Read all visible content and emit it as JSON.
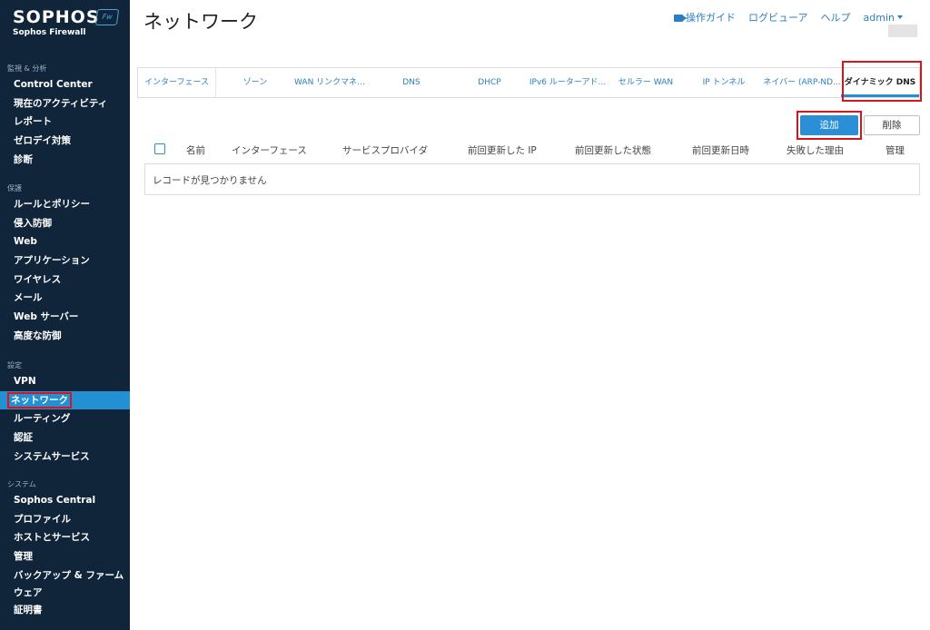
{
  "brand": {
    "logo": "SOPHOS",
    "badge": "Fw",
    "product": "Sophos Firewall"
  },
  "header": {
    "title": "ネットワーク",
    "links": {
      "guide": "操作ガイド",
      "log_viewer": "ログビューア",
      "help": "ヘルプ",
      "user": "admin"
    }
  },
  "sidebar": {
    "sections": [
      {
        "title": "監視 & 分析",
        "items": [
          "Control Center",
          "現在のアクティビティ",
          "レポート",
          "ゼロデイ対策",
          "診断"
        ]
      },
      {
        "title": "保護",
        "items": [
          "ルールとポリシー",
          "侵入防御",
          "Web",
          "アプリケーション",
          "ワイヤレス",
          "メール",
          "Web サーバー",
          "高度な防御"
        ]
      },
      {
        "title": "設定",
        "items": [
          "VPN",
          "ネットワーク",
          "ルーティング",
          "認証",
          "システムサービス"
        ]
      },
      {
        "title": "システム",
        "items": [
          "Sophos Central",
          "プロファイル",
          "ホストとサービス",
          "管理",
          "バックアップ & ファームウェア",
          "証明書"
        ]
      }
    ],
    "active_item": "ネットワーク"
  },
  "tabs": [
    "インターフェース",
    "ゾーン",
    "WAN リンクマネー...",
    "DNS",
    "DHCP",
    "IPv6 ルーターアド...",
    "セルラー WAN",
    "IP トンネル",
    "ネイバー (ARP-ND...",
    "ダイナミック DNS"
  ],
  "active_tab": "ダイナミック DNS",
  "actions": {
    "add": "追加",
    "delete": "削除"
  },
  "table": {
    "columns": [
      "名前",
      "インターフェース",
      "サービスプロバイダ",
      "前回更新した IP",
      "前回更新した状態",
      "前回更新日時",
      "失敗した理由",
      "管理"
    ],
    "empty_message": "レコードが見つかりません"
  },
  "colors": {
    "sidebar_bg": "#10253a",
    "active_bg": "#2290d3",
    "accent": "#2a8fd6",
    "highlight": "#d9141b"
  }
}
